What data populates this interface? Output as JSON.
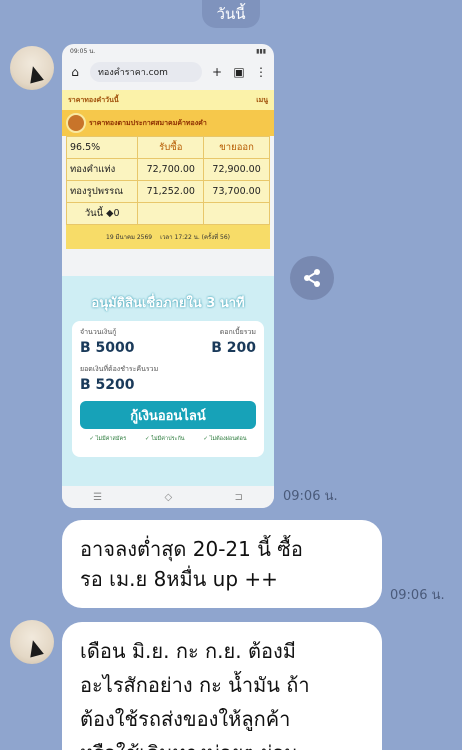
{
  "date_label": "วันนี้",
  "screenshot": {
    "status_time": "09:05 น.",
    "url": "ทองคำราคา.com",
    "site_header_left": "ราคาทองคำวันนี้",
    "site_header_right": "เมนู",
    "association_title": "ราคาทองตามประกาศสมาคมค้าทองคำ",
    "table": {
      "headers": [
        "96.5%",
        "รับซื้อ",
        "ขายออก"
      ],
      "rows": [
        [
          "ทองคำแท่ง",
          "72,700.00",
          "72,900.00"
        ],
        [
          "ทองรูปพรรณ",
          "71,252.00",
          "73,700.00"
        ],
        [
          "วันนี้ ◆0",
          "",
          ""
        ]
      ]
    },
    "footer_date": "19 มีนาคม 2569",
    "footer_time": "เวลา 17:22 น. (ครั้งที่ 56)",
    "ad": {
      "title": "อนุมัติสินเชื่อภายใน 3 นาที",
      "loan_label": "จำนวนเงินกู้",
      "interest_label": "ดอกเบี้ยรวม",
      "loan_amount": "B 5000",
      "interest_amount": "B 200",
      "total_label": "ยอดเงินที่ต้องชำระคืนรวม",
      "total_amount": "B 5200",
      "button": "กู้เงินออนไลน์",
      "features": [
        "✓ ไม่มีค่าสมัคร",
        "✓ ไม่มีค่าประกัน",
        "✓ ไม่ต้องผ่อนต่อน"
      ]
    }
  },
  "messages": [
    {
      "time": "09:06 น."
    },
    {
      "text_line1": "อาจลงต่ำสุด 20-21 นี้  ซื้อ",
      "text_line2": "รอ เม.ย 8หมื่น up ++",
      "time": "09:06 น."
    },
    {
      "text_line1": "เดือน มิ.ย. กะ ก.ย. ต้องมี",
      "text_line2": "อะไรสักอย่าง กะ น้ำมัน  ถ้า",
      "text_line3": "ต้องใช้รถส่งของให้ลูกค้า",
      "text_line4": "หรือใช้เดินทางบ่อยๆ ผ่อน"
    }
  ],
  "colors": {
    "background": "#8fa5ce",
    "bubble": "#ffffff",
    "gold": "#f6c84b"
  }
}
